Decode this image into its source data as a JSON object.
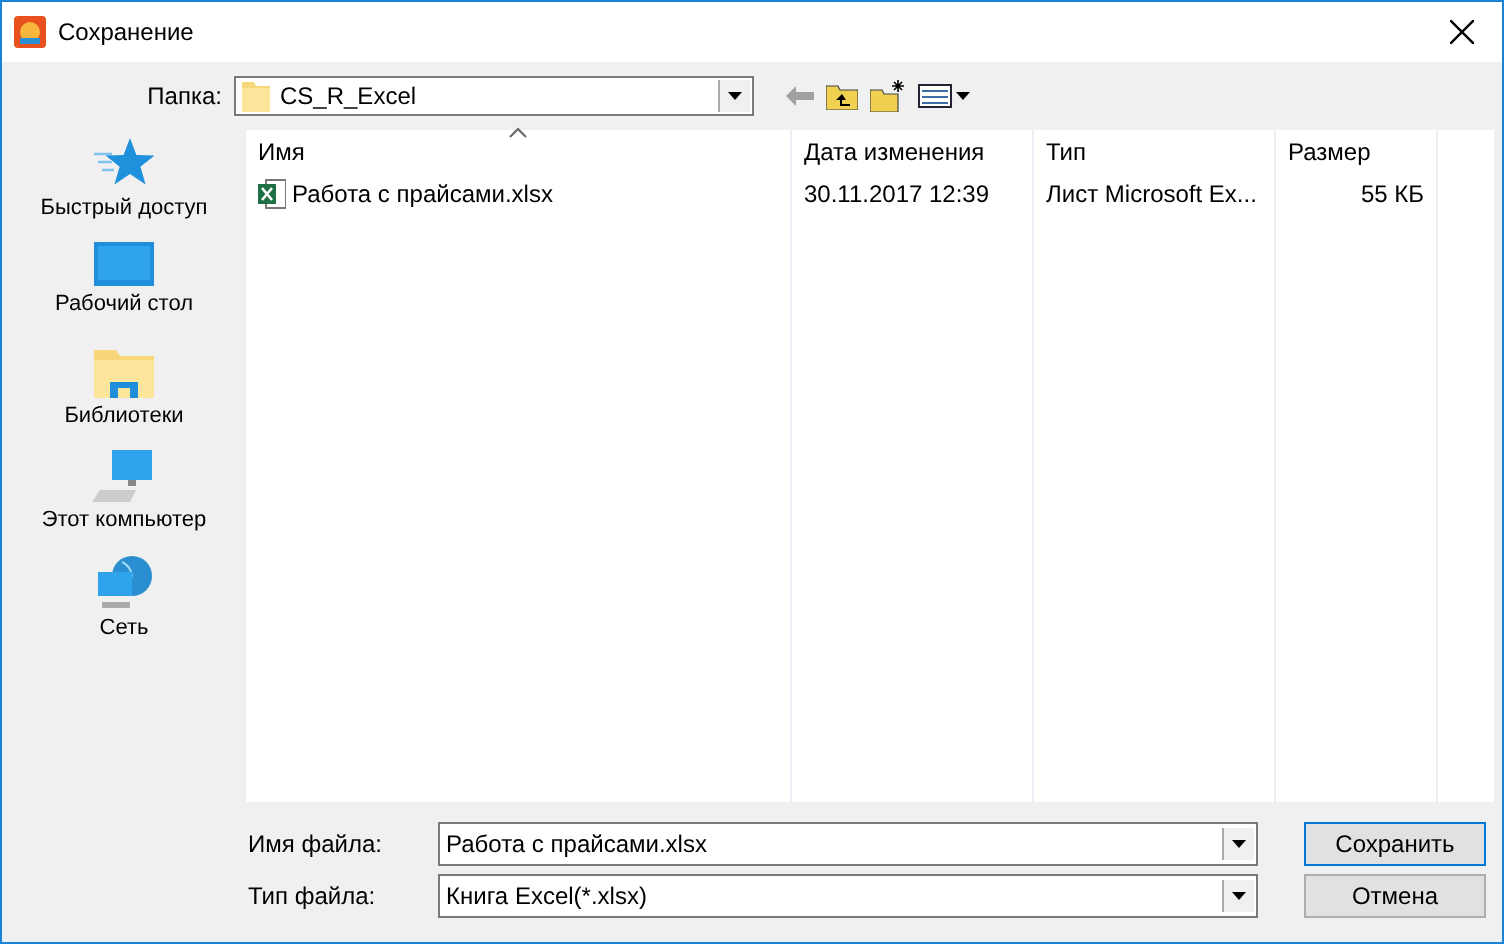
{
  "window": {
    "title": "Сохранение"
  },
  "folder_bar": {
    "label": "Папка:",
    "value": "CS_R_Excel"
  },
  "sidebar": {
    "items": [
      {
        "label": "Быстрый доступ",
        "kind": "star",
        "selected": false
      },
      {
        "label": "Рабочий стол",
        "kind": "desktop",
        "selected": false
      },
      {
        "label": "Библиотеки",
        "kind": "library",
        "selected": false
      },
      {
        "label": "Этот компьютер",
        "kind": "computer",
        "selected": false
      },
      {
        "label": "Сеть",
        "kind": "network",
        "selected": false
      }
    ]
  },
  "file_list": {
    "columns": [
      {
        "label": "Имя",
        "sorted": true
      },
      {
        "label": "Дата изменения",
        "sorted": false
      },
      {
        "label": "Тип",
        "sorted": false
      },
      {
        "label": "Размер",
        "sorted": false
      }
    ],
    "rows": [
      {
        "name": "Работа с прайсами.xlsx",
        "date": "30.11.2017 12:39",
        "type": "Лист Microsoft Ex...",
        "size": "55 КБ",
        "selected": false
      }
    ]
  },
  "file_name": {
    "label": "Имя файла:",
    "value": "Работа с прайсами.xlsx"
  },
  "file_type": {
    "label": "Тип файла:",
    "value": "Книга Excel(*.xlsx)"
  },
  "buttons": [
    "Сохранить",
    "Отмена"
  ]
}
